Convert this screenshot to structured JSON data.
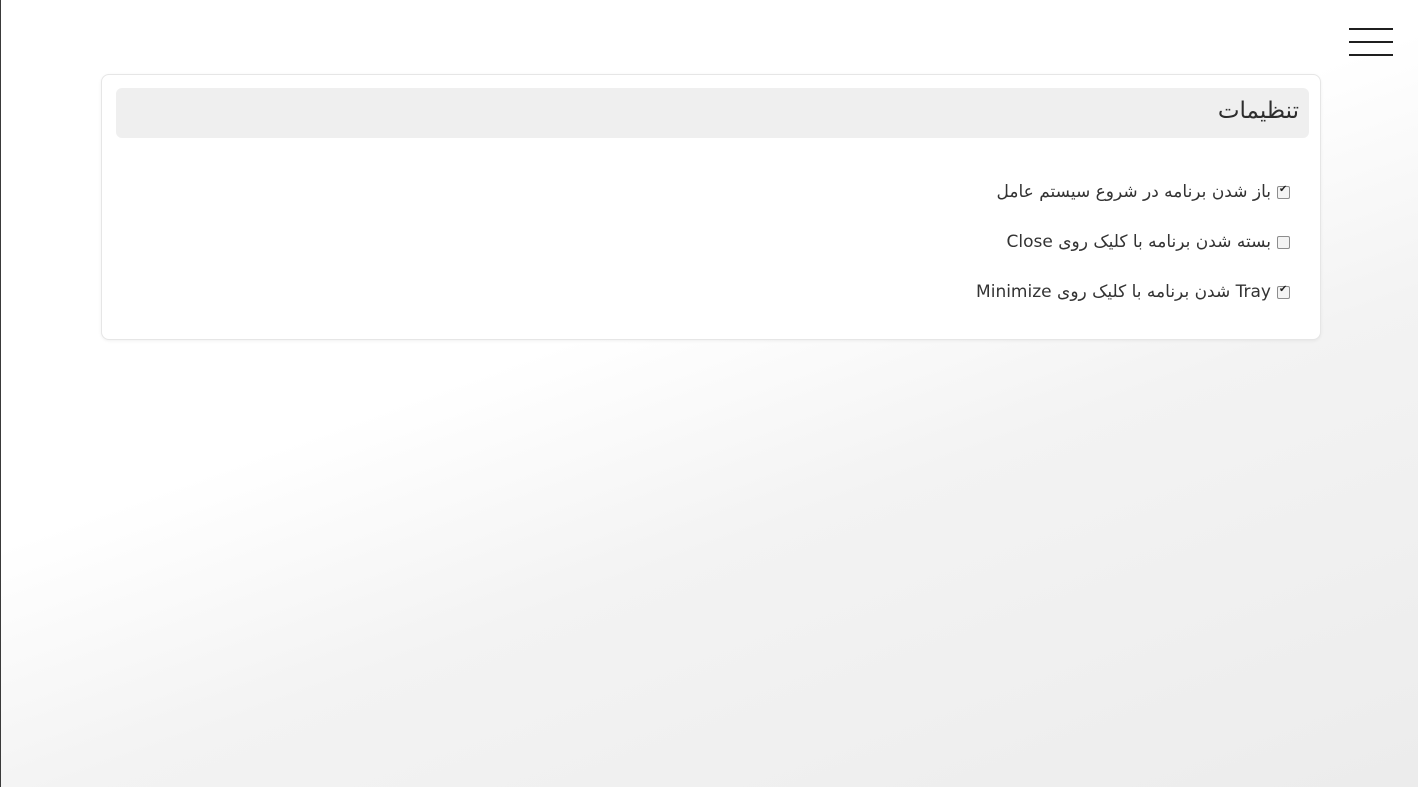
{
  "header": {
    "menu_icon": "hamburger-icon"
  },
  "settings": {
    "title": "تنظیمات",
    "options": [
      {
        "label": "باز شدن برنامه در شروع سیستم عامل",
        "checked": true
      },
      {
        "label": "بسته شدن برنامه با کلیک روی Close",
        "checked": false
      },
      {
        "label": "Tray شدن برنامه با کلیک روی Minimize",
        "checked": true
      }
    ]
  }
}
